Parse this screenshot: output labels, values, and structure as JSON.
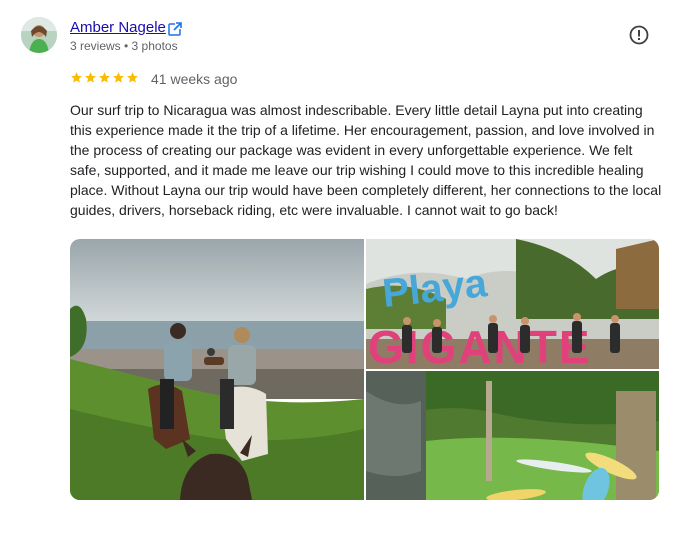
{
  "review": {
    "author": "Amber Nagele",
    "meta": "3 reviews • 3 photos",
    "rating": 5,
    "date": "41 weeks ago",
    "text": "Our surf trip to Nicaragua was almost indescribable. Every little detail Layna put into creating this experience made it the trip of a lifetime. Her encouragement, passion, and love involved in the process of creating our package was evident in every unforgettable experience. We felt safe, supported, and it made me leave our trip wishing I could move to this incredible healing place. Without Layna our trip would have been completely different, her connections to the local guides, drivers, horseback riding, etc were invaluable. I cannot wait to go back!"
  },
  "photos": {
    "sign_text_playa": "Playa",
    "sign_text_gigante": "GIGANTE"
  },
  "icons": {
    "external": "external-link-icon",
    "report": "report-icon",
    "star": "star-icon"
  },
  "colors": {
    "link": "#1a0dab",
    "star": "#fbbc04",
    "secondary_text": "#5f6368"
  }
}
